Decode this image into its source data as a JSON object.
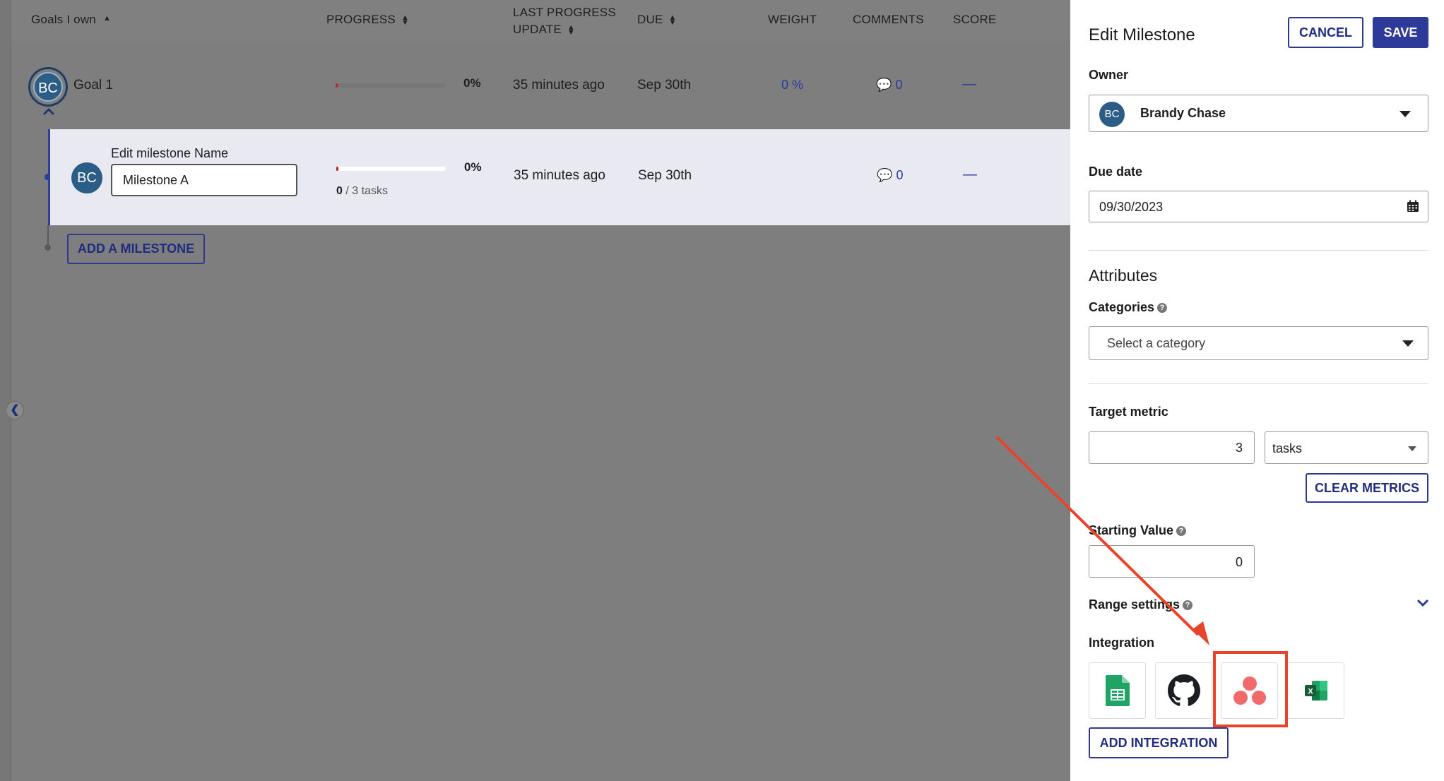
{
  "table": {
    "headers": {
      "goals": "Goals I own",
      "progress": "PROGRESS",
      "last_update_line1": "LAST PROGRESS",
      "last_update_line2": "UPDATE",
      "due": "DUE",
      "weight": "WEIGHT",
      "comments": "COMMENTS",
      "score": "SCORE"
    },
    "goal": {
      "avatar_initials": "BC",
      "name": "Goal 1",
      "progress": 0.0,
      "progress_pct": "0%",
      "last_update": "35 minutes ago",
      "due": "Sep 30th",
      "weight": "0 %",
      "comments": "0",
      "score": "—"
    },
    "milestone": {
      "avatar_initials": "BC",
      "name_label": "Edit milestone Name",
      "name_value": "Milestone A",
      "progress": 0.0,
      "progress_pct": "0%",
      "tasks_done": "0",
      "tasks_total": "/ 3  tasks",
      "last_update": "35 minutes ago",
      "due": "Sep 30th",
      "comments": "0",
      "score": "—"
    },
    "add_milestone_label": "ADD A MILESTONE"
  },
  "panel": {
    "title": "Edit Milestone",
    "cancel_label": "CANCEL",
    "save_label": "SAVE",
    "owner_label": "Owner",
    "owner_initials": "BC",
    "owner_name": "Brandy Chase",
    "due_label": "Due date",
    "due_value": "09/30/2023",
    "attributes_title": "Attributes",
    "categories_label": "Categories",
    "categories_placeholder": "Select a category",
    "target_label": "Target metric",
    "target_value": "3",
    "target_unit": "tasks",
    "clear_metrics_label": "CLEAR METRICS",
    "starting_label": "Starting Value",
    "starting_value": "0",
    "range_label": "Range settings",
    "integration_label": "Integration",
    "integrations": [
      "google-sheets-icon",
      "github-icon",
      "asana-icon",
      "excel-icon"
    ],
    "add_integration_label": "ADD INTEGRATION"
  },
  "colors": {
    "accent": "#2d3a99",
    "highlight": "#e8432b",
    "avatar": "#2c5d86",
    "overlay": "#7e7e7e"
  }
}
